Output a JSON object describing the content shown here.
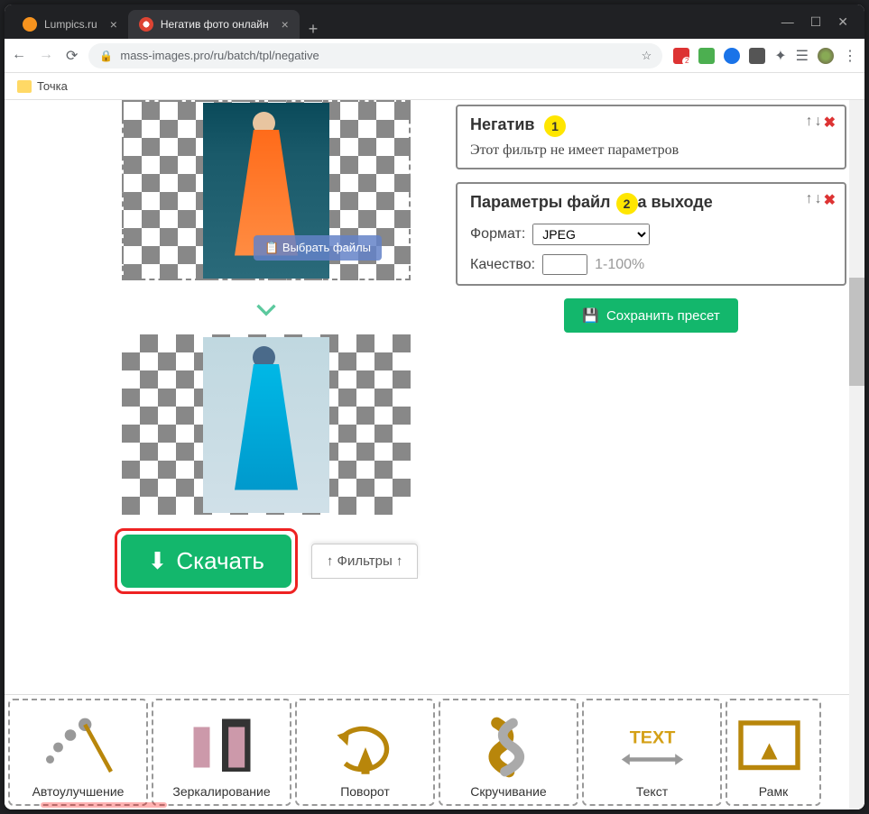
{
  "window": {
    "tabs": [
      {
        "title": "Lumpics.ru",
        "icon_color": "#f7931e",
        "active": false
      },
      {
        "title": "Негатив фото онлайн",
        "icon_color": "#d43",
        "active": true
      }
    ]
  },
  "toolbar": {
    "url": "mass-images.pro/ru/batch/tpl/negative"
  },
  "bookmarks": {
    "item1": "Точка"
  },
  "upload": {
    "select_files": "Выбрать файлы"
  },
  "download": {
    "label": "Скачать",
    "filters_label": "↑ Фильтры ↑"
  },
  "panels": {
    "negative": {
      "title": "Негатив",
      "badge": "1",
      "desc": "Этот фильтр не имеет параметров"
    },
    "output": {
      "title": "Параметры файл",
      "title_suffix": "а выходе",
      "badge": "2",
      "format_label": "Формат:",
      "format_value": "JPEG",
      "quality_label": "Качество:",
      "quality_hint": "1-100%"
    }
  },
  "save_preset": {
    "label": "Сохранить пресет"
  },
  "filters": [
    {
      "label": "Автоулучшение"
    },
    {
      "label": "Зеркалирование"
    },
    {
      "label": "Поворот"
    },
    {
      "label": "Скручивание"
    },
    {
      "label": "Текст"
    },
    {
      "label": "Рамк"
    }
  ]
}
